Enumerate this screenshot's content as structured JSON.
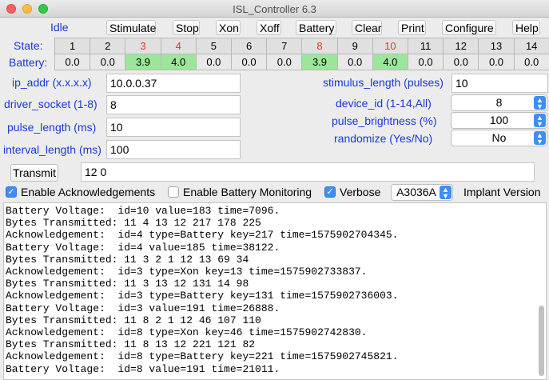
{
  "window": {
    "title": "ISL_Controller 6.3"
  },
  "status_label": "Idle",
  "toolbar": [
    {
      "key": "stimulate",
      "label": "Stimulate"
    },
    {
      "key": "stop",
      "label": "Stop"
    },
    {
      "key": "xon",
      "label": "Xon"
    },
    {
      "key": "xoff",
      "label": "Xoff"
    },
    {
      "key": "battery",
      "label": "Battery"
    },
    {
      "key": "clear",
      "label": "Clear"
    },
    {
      "key": "print",
      "label": "Print"
    },
    {
      "key": "configure",
      "label": "Configure"
    },
    {
      "key": "help",
      "label": "Help"
    }
  ],
  "grid": {
    "state_label": "State:",
    "battery_label": "Battery:",
    "states": [
      {
        "num": "1",
        "highlight": false
      },
      {
        "num": "2",
        "highlight": false
      },
      {
        "num": "3",
        "highlight": true
      },
      {
        "num": "4",
        "highlight": true
      },
      {
        "num": "5",
        "highlight": false
      },
      {
        "num": "6",
        "highlight": false
      },
      {
        "num": "7",
        "highlight": false
      },
      {
        "num": "8",
        "highlight": true
      },
      {
        "num": "9",
        "highlight": false
      },
      {
        "num": "10",
        "highlight": true
      },
      {
        "num": "11",
        "highlight": false
      },
      {
        "num": "12",
        "highlight": false
      },
      {
        "num": "13",
        "highlight": false
      },
      {
        "num": "14",
        "highlight": false
      }
    ],
    "batteries": [
      {
        "value": "0.0",
        "ok": false
      },
      {
        "value": "0.0",
        "ok": false
      },
      {
        "value": "3.9",
        "ok": true
      },
      {
        "value": "4.0",
        "ok": true
      },
      {
        "value": "0.0",
        "ok": false
      },
      {
        "value": "0.0",
        "ok": false
      },
      {
        "value": "0.0",
        "ok": false
      },
      {
        "value": "3.9",
        "ok": true
      },
      {
        "value": "0.0",
        "ok": false
      },
      {
        "value": "4.0",
        "ok": true
      },
      {
        "value": "0.0",
        "ok": false
      },
      {
        "value": "0.0",
        "ok": false
      },
      {
        "value": "0.0",
        "ok": false
      },
      {
        "value": "0.0",
        "ok": false
      }
    ],
    "colors": {
      "highlight_text": "#e8342b",
      "battery_ok": "#9be69b"
    }
  },
  "fields": {
    "ip_addr": {
      "label": "ip_addr (x.x.x.x)",
      "value": "10.0.0.37"
    },
    "driver_socket": {
      "label": "driver_socket (1-8)",
      "value": "8"
    },
    "pulse_length": {
      "label": "pulse_length (ms)",
      "value": "10"
    },
    "interval_length": {
      "label": "interval_length (ms)",
      "value": "100"
    },
    "stimulus_length": {
      "label": "stimulus_length (pulses)",
      "value": "10"
    },
    "device_id": {
      "label": "device_id (1-14,All)",
      "value": "8"
    },
    "pulse_brightness": {
      "label": "pulse_brightness (%)",
      "value": "100"
    },
    "randomize": {
      "label": "randomize (Yes/No)",
      "value": "No"
    }
  },
  "transmit": {
    "label": "Transmit",
    "value": "12 0"
  },
  "options": {
    "enable_ack": {
      "label": "Enable Acknowledgements",
      "checked": true
    },
    "enable_battery": {
      "label": "Enable Battery Monitoring",
      "checked": false
    },
    "verbose": {
      "label": "Verbose",
      "checked": true
    },
    "implant_model": "A3036A",
    "implant_version_label": "Implant Version"
  },
  "log_lines": [
    "Battery Voltage:  id=10 value=183 time=7096.",
    "Bytes Transmitted: 11 4 13 12 217 178 225",
    "Acknowledgement:  id=4 type=Battery key=217 time=1575902704345.",
    "Battery Voltage:  id=4 value=185 time=38122.",
    "Bytes Transmitted: 11 3 2 1 12 13 69 34",
    "Acknowledgement:  id=3 type=Xon key=13 time=1575902733837.",
    "Bytes Transmitted: 11 3 13 12 131 14 98",
    "Acknowledgement:  id=3 type=Battery key=131 time=1575902736003.",
    "Battery Voltage:  id=3 value=191 time=26888.",
    "Bytes Transmitted: 11 8 2 1 12 46 107 110",
    "Acknowledgement:  id=8 type=Xon key=46 time=1575902742830.",
    "Bytes Transmitted: 11 8 13 12 221 121 82",
    "Acknowledgement:  id=8 type=Battery key=221 time=1575902745821.",
    "Battery Voltage:  id=8 value=191 time=21011."
  ]
}
